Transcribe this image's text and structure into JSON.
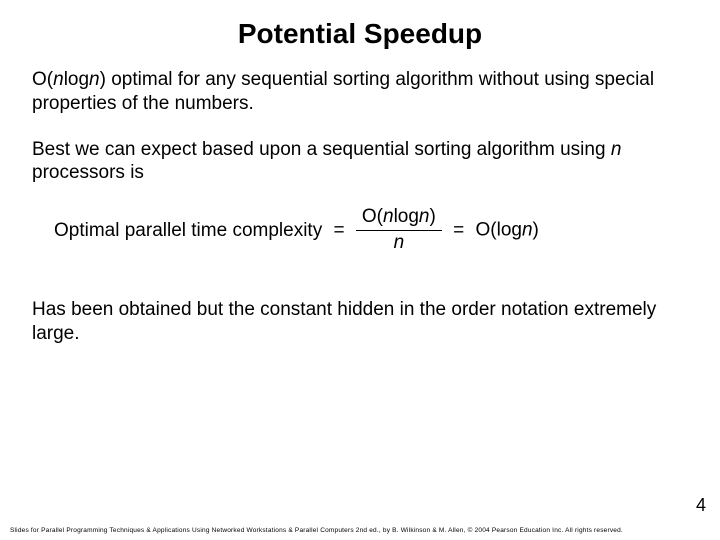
{
  "title": "Potential Speedup",
  "para1": {
    "segments": [
      {
        "text": "O(",
        "italic": false
      },
      {
        "text": "n",
        "italic": true
      },
      {
        "text": "log",
        "italic": false
      },
      {
        "text": "n",
        "italic": true
      },
      {
        "text": ") optimal for any sequential sorting algorithm without using special properties of the numbers.",
        "italic": false
      }
    ]
  },
  "para2": {
    "segments": [
      {
        "text": "Best we can expect based upon a sequential sorting algorithm using ",
        "italic": false
      },
      {
        "text": "n",
        "italic": true
      },
      {
        "text": " processors is",
        "italic": false
      }
    ]
  },
  "formula": {
    "lhs": "Optimal parallel time complexity",
    "eq": "=",
    "fraction": {
      "numerator": {
        "segments": [
          {
            "text": "O(",
            "italic": false
          },
          {
            "text": "n",
            "italic": true
          },
          {
            "text": "log",
            "italic": false
          },
          {
            "text": "n",
            "italic": true
          },
          {
            "text": ")",
            "italic": false
          }
        ]
      },
      "denominator": {
        "segments": [
          {
            "text": "n",
            "italic": true
          }
        ]
      }
    },
    "rhs": {
      "segments": [
        {
          "text": "O(log",
          "italic": false
        },
        {
          "text": "n",
          "italic": true
        },
        {
          "text": ")",
          "italic": false
        }
      ]
    }
  },
  "para3": "Has been obtained but the constant hidden in the order notation extremely large.",
  "page_number": "4",
  "footer": "Slides for Parallel Programming Techniques & Applications Using Networked Workstations & Parallel Computers 2nd ed., by B. Wilkinson & M. Allen, © 2004 Pearson Education Inc. All rights reserved."
}
